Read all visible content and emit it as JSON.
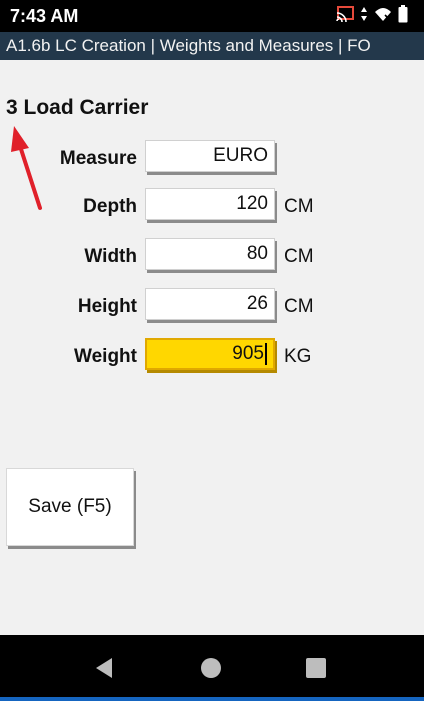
{
  "status_bar": {
    "time": "7:43 AM",
    "icons": [
      "cast-icon",
      "data-arrows-icon",
      "wifi-icon",
      "battery-icon"
    ]
  },
  "title_bar": {
    "title": "A1.6b LC Creation | Weights and Measures | FO"
  },
  "section": {
    "title": "3 Load Carrier"
  },
  "form": {
    "fields": [
      {
        "label": "Measure",
        "value": "EURO",
        "unit": ""
      },
      {
        "label": "Depth",
        "value": "120",
        "unit": "CM"
      },
      {
        "label": "Width",
        "value": "80",
        "unit": "CM"
      },
      {
        "label": "Height",
        "value": "26",
        "unit": "CM"
      },
      {
        "label": "Weight",
        "value": "905",
        "unit": "KG"
      }
    ]
  },
  "actions": {
    "save_label": "Save (F5)"
  },
  "nav_bar": {
    "icons": [
      "back-icon",
      "home-icon",
      "recents-icon"
    ]
  },
  "colors": {
    "title_bar_bg": "#23384b",
    "active_field_bg": "#ffd700",
    "annotation_arrow": "#e0202a",
    "nav_accent": "#1565c0"
  }
}
